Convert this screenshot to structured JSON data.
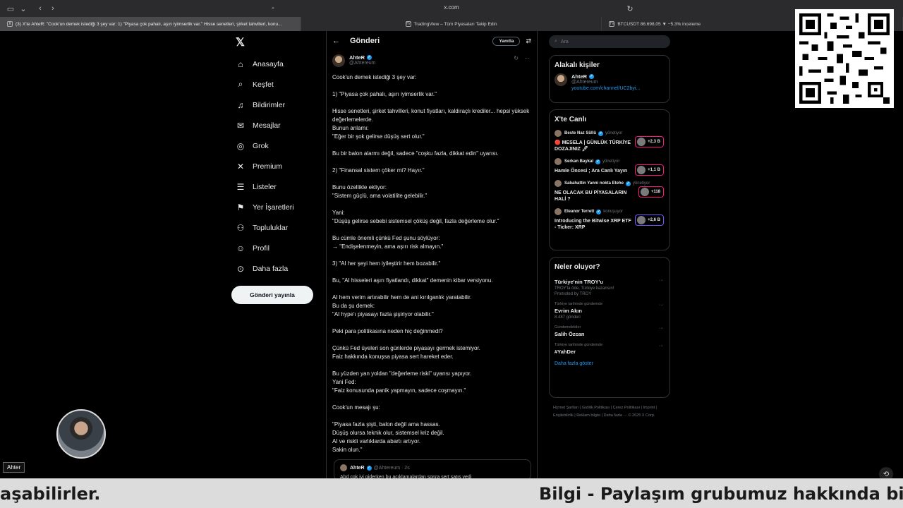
{
  "browser": {
    "url": "x.com",
    "tabs": [
      {
        "label": "(3) X'te AhteR: \"Cook'un demek istediği 3 şey var: 1) \"Piyasa çok pahalı, aşırı iyimserlik var.\" Hisse senetleri, şirket tahvilleri, konu...",
        "favicon": "X",
        "active": true
      },
      {
        "label": "TradingView – Tüm Piyasaları Takip Edin",
        "favicon": "TV",
        "active": false
      },
      {
        "label": "BTCUSDT 86.698,05 ▼ −5.3% inceleme",
        "favicon": "TV",
        "active": false
      }
    ]
  },
  "nav": {
    "logo": "𝕏",
    "items": [
      {
        "label": "Anasayfa",
        "icon": "home-icon",
        "glyph": "⌂"
      },
      {
        "label": "Keşfet",
        "icon": "search-icon",
        "glyph": "⌕"
      },
      {
        "label": "Bildirimler",
        "icon": "bell-icon",
        "glyph": "♫"
      },
      {
        "label": "Mesajlar",
        "icon": "envelope-icon",
        "glyph": "✉"
      },
      {
        "label": "Grok",
        "icon": "grok-icon",
        "glyph": "◎"
      },
      {
        "label": "Premium",
        "icon": "x-premium-icon",
        "glyph": "✕"
      },
      {
        "label": "Listeler",
        "icon": "list-icon",
        "glyph": "☰"
      },
      {
        "label": "Yer İşaretleri",
        "icon": "bookmark-icon",
        "glyph": "⚑"
      },
      {
        "label": "Topluluklar",
        "icon": "people-icon",
        "glyph": "⚇"
      },
      {
        "label": "Profil",
        "icon": "person-icon",
        "glyph": "☺"
      },
      {
        "label": "Daha fazla",
        "icon": "more-circle-icon",
        "glyph": "⊙"
      }
    ],
    "post_button": "Gönderi yayınla"
  },
  "post": {
    "header_title": "Gönderi",
    "reply_button": "Yanıtla",
    "author_name": "AhteR",
    "author_handle": "@Ahtereum",
    "body": [
      "Cook'un demek istediği 3 şey var:",
      "",
      "1) \"Piyasa çok pahalı, aşırı iyimserlik var.\"",
      "",
      "Hisse senetleri, şirket tahvilleri, konut fiyatları, kaldıraçlı krediler... hepsi yüksek değerlemelerde.",
      "Bunun anlamı:",
      "\"Eğer bir şok gelirse düşüş sert olur.\"",
      "",
      "Bu bir balon alarmı değil, sadece \"coşku fazla, dikkat edin\" uyarısı.",
      "",
      "2) \"Finansal sistem çöker mi? Hayır.\"",
      "",
      "Bunu özellikle ekliyor:",
      "\"Sistem güçlü, ama volatilite gelebilir.\"",
      "",
      "Yani:",
      "\"Düşüş gelirse sebebi sistemsel çöküş değil, fazla değerleme olur.\"",
      "",
      "Bu cümle önemli çünkü Fed şunu söylüyor:",
      "→ \"Endişelenmeyin, ama aşırı risk almayın.\"",
      "",
      "3) \"AI her şeyi hem iyileştirir hem bozabilir.\"",
      "",
      "Bu, \"AI hisseleri aşırı fiyatlandı, dikkat\" demenin kibar versiyonu.",
      "",
      "AI hem verim artırabilir hem de ani kırılganlık yaratabilir.",
      "Bu da şu demek:",
      "\"AI hype'ı piyasayı fazla şişiriyor olabilir.\"",
      "",
      "Peki para politikasına neden hiç değinmedi?",
      "",
      "Çünkü Fed üyeleri son günlerde piyasayı germek istemiyor.",
      "Faiz hakkında konuşsa piyasa sert hareket eder.",
      "",
      "Bu yüzden yan yoldan \"değerleme riski\" uyarısı yapıyor.",
      "Yani Fed:",
      "\"Faiz konusunda panik yapmayın, sadece coşmayın.\"",
      "",
      "Cook'un mesajı şu:",
      "",
      "\"Piyasa fazla şişti, balon değil ama hassas.",
      "Düşüş olursa teknik olur, sistemsel kriz değil.",
      "AI ve riskli varlıklarda abartı artıyor.",
      "Sakin olun.\""
    ],
    "quote": {
      "author": "AhteR",
      "handle": "@Ahtereum · 2s",
      "text": "Abd çok iyi giderken bu açıklamalardan sonra sert satış yedi"
    }
  },
  "right": {
    "search_placeholder": "Ara",
    "related": {
      "title": "Alakalı kişiler",
      "name": "AhteR",
      "handle": "@Ahtereum",
      "link": "youtube.com/channel/UC2byi..."
    },
    "live": {
      "title": "X'te Canlı",
      "items": [
        {
          "host": "Beste Naz Süllü",
          "role": "yönetiyor",
          "title": "🔴 MESELA | GÜNLÜK TÜRKİYE DOZAJINIZ 🖊",
          "count": "+2,3 B",
          "border": "#f91880"
        },
        {
          "host": "Serkan Baykal",
          "role": "yönetiyor",
          "title": "Hamle Öncesi ; Ara Canlı Yayın",
          "count": "+1,1 B",
          "border": "#f91880"
        },
        {
          "host": "Sabahattin Yanni nokta Etehe",
          "role": "yönetiyor",
          "title": "NE OLACAK BU PİYASALARIN HALİ ?",
          "count": "+118",
          "border": "#f91880"
        },
        {
          "host": "Eleanor Terrett",
          "role": "konuşuyor",
          "title": "Introducing the Bitwise XRP ETF - Ticker: XRP",
          "count": "+2,6 B",
          "border": "#7856ff"
        }
      ]
    },
    "trends": {
      "title": "Neler oluyor?",
      "items": [
        {
          "context": "",
          "name": "Türkiye'nin TROY'u",
          "sub": "TROY'la öde, Türkiye kazansın!",
          "sub2": "Promoted by TROY"
        },
        {
          "context": "Türkiye tarihinde gündemde",
          "name": "Evrim Akın",
          "sub": "8.487 gönderi",
          "sub2": ""
        },
        {
          "context": "Gündemdekiler",
          "name": "Salih Özcan",
          "sub": "",
          "sub2": ""
        },
        {
          "context": "Türkiye tarihinde gündemde",
          "name": "#YahDer",
          "sub": "",
          "sub2": ""
        }
      ],
      "show_more": "Daha fazla göster"
    },
    "footer": "Hizmet Şartları | Gizlilik Politikası | Çerez Politikası | Imprint | Erişilebilirlik | Reklam bilgisi | Daha fazla ··· © 2025 X Corp."
  },
  "overlay": {
    "cam_label": "Ahter",
    "ticker_left": "aşabilirler.",
    "ticker_right": "Bilgi - Paylaşım grubumuz hakkında bilgi al"
  }
}
